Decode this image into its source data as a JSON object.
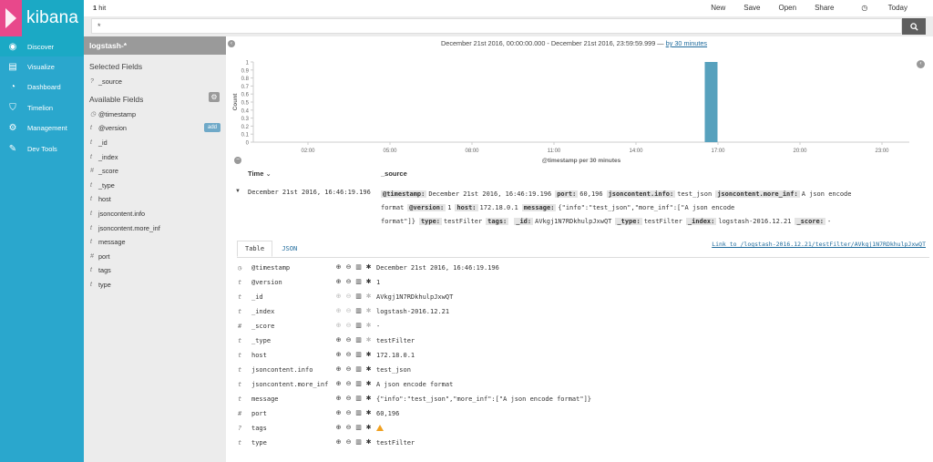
{
  "nav": {
    "logo": "kibana",
    "items": [
      {
        "label": "Discover",
        "icon": "compass-icon",
        "active": true
      },
      {
        "label": "Visualize",
        "icon": "bar-chart-icon",
        "active": false
      },
      {
        "label": "Dashboard",
        "icon": "dashboard-icon",
        "active": false
      },
      {
        "label": "Timelion",
        "icon": "shield-icon",
        "active": false
      },
      {
        "label": "Management",
        "icon": "gear-icon",
        "active": false
      },
      {
        "label": "Dev Tools",
        "icon": "wrench-icon",
        "active": false
      }
    ]
  },
  "topbar": {
    "hits_count": "1",
    "hits_label": "hit",
    "links": [
      "New",
      "Save",
      "Open",
      "Share"
    ],
    "time_label": "Today",
    "query": "*"
  },
  "sidebar": {
    "index_pattern": "logstash-*",
    "selected_title": "Selected Fields",
    "selected": [
      {
        "type": "?",
        "name": "_source"
      }
    ],
    "available_title": "Available Fields",
    "add_label": "add",
    "available": [
      {
        "type": "◷",
        "name": "@timestamp"
      },
      {
        "type": "t",
        "name": "@version"
      },
      {
        "type": "t",
        "name": "_id"
      },
      {
        "type": "t",
        "name": "_index"
      },
      {
        "type": "#",
        "name": "_score"
      },
      {
        "type": "t",
        "name": "_type"
      },
      {
        "type": "t",
        "name": "host"
      },
      {
        "type": "t",
        "name": "jsoncontent.info"
      },
      {
        "type": "t",
        "name": "jsoncontent.more_inf"
      },
      {
        "type": "t",
        "name": "message"
      },
      {
        "type": "#",
        "name": "port"
      },
      {
        "type": "t",
        "name": "tags"
      },
      {
        "type": "t",
        "name": "type"
      }
    ]
  },
  "range": {
    "text": "December 21st 2016, 00:00:00.000 - December 21st 2016, 23:59:59.999 —",
    "link": "by 30 minutes"
  },
  "chart_data": {
    "type": "bar",
    "xlabel": "@timestamp per 30 minutes",
    "ylabel": "Count",
    "x_ticks": [
      "02:00",
      "05:00",
      "08:00",
      "11:00",
      "14:00",
      "17:00",
      "20:00",
      "23:00"
    ],
    "y_ticks": [
      "0",
      "0.1",
      "0.2",
      "0.3",
      "0.4",
      "0.5",
      "0.6",
      "0.7",
      "0.8",
      "0.9",
      "1"
    ],
    "ylim": [
      0,
      1
    ],
    "xlim_hours": [
      0,
      24
    ],
    "bars": [
      {
        "start_hour": 16.5,
        "end_hour": 17.0,
        "value": 1
      }
    ],
    "bar_color": "#57a1bd",
    "grid": false
  },
  "table": {
    "col_time": "Time",
    "col_source": "_source",
    "rows": [
      {
        "time": "December 21st 2016, 16:46:19.196",
        "source": [
          {
            "k": "@timestamp:",
            "v": "December 21st 2016, 16:46:19.196"
          },
          {
            "k": "port:",
            "v": "60,196"
          },
          {
            "k": "jsoncontent.info:",
            "v": "test_json"
          },
          {
            "k": "jsoncontent.more_inf:",
            "v": "A json encode format"
          },
          {
            "k": "@version:",
            "v": "1"
          },
          {
            "k": "host:",
            "v": "172.18.0.1"
          },
          {
            "k": "message:",
            "v": "{\"info\":\"test_json\",\"more_inf\":[\"A json encode format\"]}"
          },
          {
            "k": "type:",
            "v": "testFilter"
          },
          {
            "k": "tags:",
            "v": ""
          },
          {
            "k": "_id:",
            "v": "AVkgj1N7RDkhulpJxwQT"
          },
          {
            "k": "_type:",
            "v": "testFilter"
          },
          {
            "k": "_index:",
            "v": "logstash-2016.12.21"
          },
          {
            "k": "_score:",
            "v": "-"
          }
        ]
      }
    ]
  },
  "detail": {
    "tab_table": "Table",
    "tab_json": "JSON",
    "link": "Link to /logstash-2016.12.21/testFilter/AVkgj1N7RDkhulpJxwQT",
    "rows": [
      {
        "type": "◷",
        "name": "@timestamp",
        "value": "December 21st 2016, 16:46:19.196"
      },
      {
        "type": "t",
        "name": "@version",
        "value": "1"
      },
      {
        "type": "t",
        "name": "_id",
        "value": "AVkgj1N7RDkhulpJxwQT"
      },
      {
        "type": "t",
        "name": "_index",
        "value": "logstash-2016.12.21"
      },
      {
        "type": "#",
        "name": "_score",
        "value": "-"
      },
      {
        "type": "t",
        "name": "_type",
        "value": "testFilter"
      },
      {
        "type": "t",
        "name": "host",
        "value": "172.18.0.1"
      },
      {
        "type": "t",
        "name": "jsoncontent.info",
        "value": "test_json"
      },
      {
        "type": "t",
        "name": "jsoncontent.more_inf",
        "value": "A json encode format"
      },
      {
        "type": "t",
        "name": "message",
        "value": "{\"info\":\"test_json\",\"more_inf\":[\"A json encode format\"]}"
      },
      {
        "type": "#",
        "name": "port",
        "value": "60,196"
      },
      {
        "type": "?",
        "name": "tags",
        "value": "",
        "warning": true
      },
      {
        "type": "t",
        "name": "type",
        "value": "testFilter"
      }
    ]
  }
}
